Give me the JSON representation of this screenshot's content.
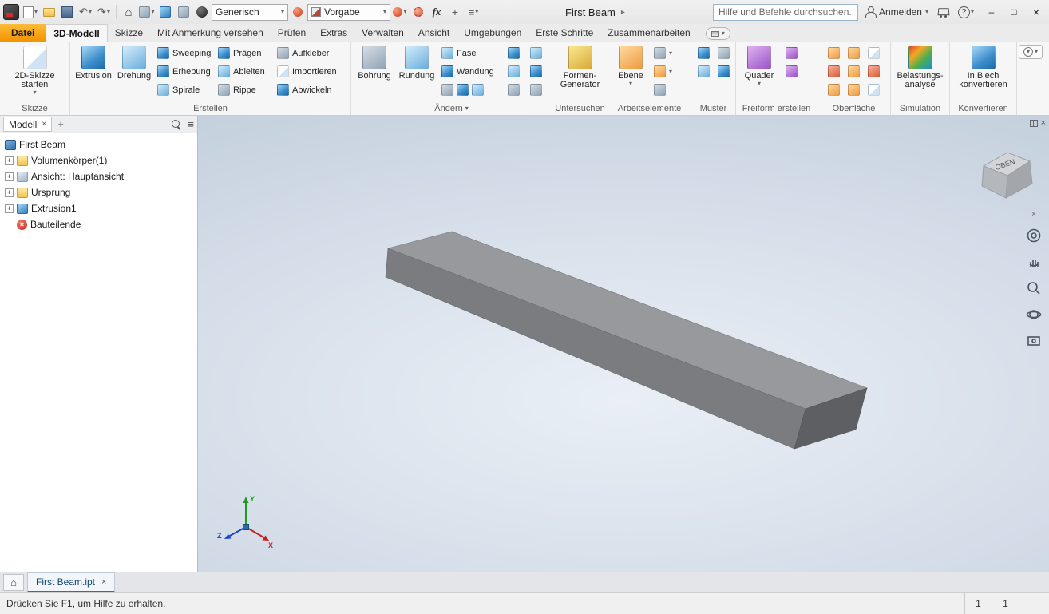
{
  "icons": {
    "close": "×",
    "minimize": "–",
    "maximize": "□",
    "caret": "▾",
    "chevron": "▸",
    "plus": "+",
    "hamburger": "≡",
    "home": "⌂",
    "undo": "↶",
    "redo": "↷",
    "fx": "fx",
    "help": "?",
    "expander": "+"
  },
  "titlebar": {
    "doc_title": "First Beam",
    "material_value": "Generisch",
    "appearance_value": "Vorgabe",
    "search_placeholder": "Hilfe und Befehle durchsuchen...",
    "signin_label": "Anmelden"
  },
  "tabrow": {
    "file_tab": "Datei",
    "tabs": [
      "3D-Modell",
      "Skizze",
      "Mit Anmerkung versehen",
      "Prüfen",
      "Extras",
      "Verwalten",
      "Ansicht",
      "Umgebungen",
      "Erste Schritte",
      "Zusammenarbeiten"
    ]
  },
  "ribbon": {
    "skizze": {
      "label": "Skizze",
      "start2d": "2D-Skizze starten"
    },
    "erstellen": {
      "label": "Erstellen",
      "extrusion": "Extrusion",
      "drehung": "Drehung",
      "smalls": [
        "Sweeping",
        "Erhebung",
        "Spirale",
        "Prägen",
        "Ableiten",
        "Rippe",
        "Aufkleber",
        "Importieren",
        "Abwickeln"
      ]
    },
    "aendern": {
      "label": "Ändern",
      "bohrung": "Bohrung",
      "rundung": "Rundung",
      "fase": "Fase",
      "wandung": "Wandung"
    },
    "untersuchen": {
      "label": "Untersuchen",
      "formen": "Formen-Generator"
    },
    "arbeitselemente": {
      "label": "Arbeitselemente",
      "ebene": "Ebene"
    },
    "muster": {
      "label": "Muster"
    },
    "freiform": {
      "label": "Freiform erstellen",
      "quader": "Quader"
    },
    "oberflaeche": {
      "label": "Oberfläche"
    },
    "simulation": {
      "label": "Simulation",
      "analyse": "Belastungs-analyse"
    },
    "konvertieren": {
      "label": "Konvertieren",
      "blech": "In Blech konvertieren"
    }
  },
  "browser": {
    "panel_tab": "Modell",
    "tree": [
      {
        "label": "First Beam"
      },
      {
        "label": "Volumenkörper(1)"
      },
      {
        "label": "Ansicht: Hauptansicht"
      },
      {
        "label": "Ursprung"
      },
      {
        "label": "Extrusion1"
      },
      {
        "label": "Bauteilende"
      }
    ]
  },
  "viewport": {
    "viewcube_top": "OBEN",
    "triad": {
      "x": "X",
      "y": "Y",
      "z": "Z"
    }
  },
  "doctabs": {
    "active_tab": "First Beam.ipt"
  },
  "statusbar": {
    "hint": "Drücken Sie F1, um Hilfe zu erhalten.",
    "cell1": "1",
    "cell2": "1"
  }
}
